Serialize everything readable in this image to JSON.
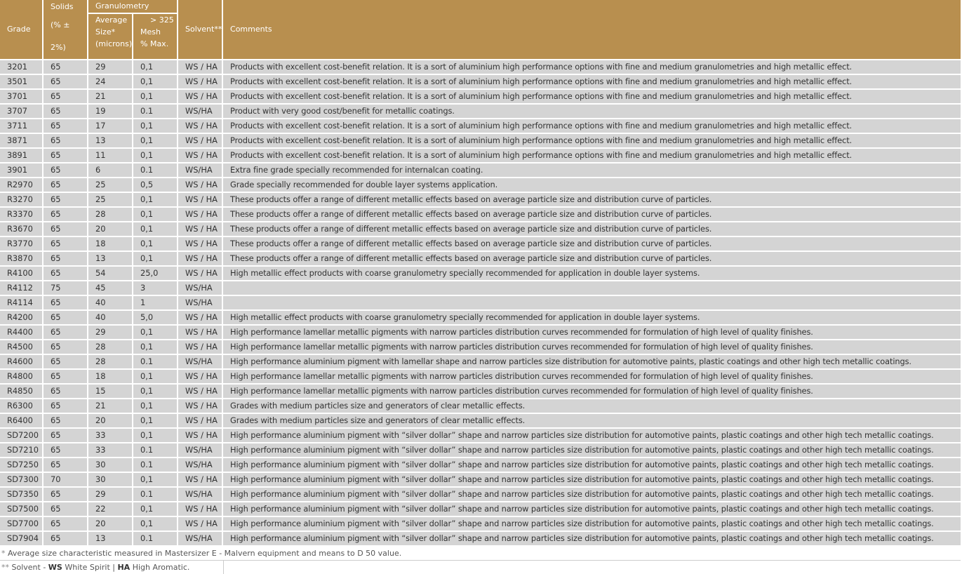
{
  "headers": {
    "grade": "Grade",
    "solids_top": "Solids",
    "solids_sub": "(% ± 2%)",
    "granulometry": "Granulometry",
    "avg_size": [
      "Average",
      "Size*",
      "(microns)"
    ],
    "mesh": [
      "> 325",
      "Mesh",
      "% Max."
    ],
    "solvent": "Solvent**",
    "comments": "Comments"
  },
  "rows": [
    {
      "grade": "3201",
      "solids": "65",
      "size": "29",
      "mesh": "0,1",
      "solvent": "WS / HA",
      "comment": "Products with excellent cost-benefit relation. It is a sort of aluminium high performance options with fine and medium granulometries and high metallic effect."
    },
    {
      "grade": "3501",
      "solids": "65",
      "size": "24",
      "mesh": "0,1",
      "solvent": "WS / HA",
      "comment": "Products with excellent cost-benefit relation. It is a sort of aluminium high performance options with fine and medium granulometries and high metallic effect."
    },
    {
      "grade": "3701",
      "solids": "65",
      "size": "21",
      "mesh": "0,1",
      "solvent": "WS / HA",
      "comment": "Products with excellent cost-benefit relation. It is a sort of aluminium high performance options with fine and medium granulometries and high metallic effect."
    },
    {
      "grade": "3707",
      "solids": "65",
      "size": "19",
      "mesh": "0.1",
      "solvent": "WS/HA",
      "comment": "Product with very good cost/benefit for metallic coatings."
    },
    {
      "grade": "3711",
      "solids": "65",
      "size": "17",
      "mesh": "0,1",
      "solvent": "WS / HA",
      "comment": "Products with excellent cost-benefit relation. It is a sort of aluminium high performance options with fine and medium granulometries and high metallic effect."
    },
    {
      "grade": "3871",
      "solids": "65",
      "size": "13",
      "mesh": "0,1",
      "solvent": "WS / HA",
      "comment": "Products with excellent cost-benefit relation. It is a sort of aluminium high performance options with fine and medium granulometries and high metallic effect."
    },
    {
      "grade": "3891",
      "solids": "65",
      "size": "11",
      "mesh": "0,1",
      "solvent": "WS / HA",
      "comment": "Products with excellent cost-benefit relation. It is a sort of aluminium high performance options with fine and medium granulometries and high metallic effect."
    },
    {
      "grade": "3901",
      "solids": "65",
      "size": "6",
      "mesh": "0.1",
      "solvent": "WS/HA",
      "comment": "Extra fine grade specially recommended for internalcan coating."
    },
    {
      "grade": "R2970",
      "solids": "65",
      "size": "25",
      "mesh": "0,5",
      "solvent": "WS / HA",
      "comment": "Grade specially recommended for double layer systems application."
    },
    {
      "grade": "R3270",
      "solids": "65",
      "size": "25",
      "mesh": "0,1",
      "solvent": "WS / HA",
      "comment": "These products offer a range of different metallic effects based on average particle size and distribution curve of particles."
    },
    {
      "grade": "R3370",
      "solids": "65",
      "size": "28",
      "mesh": "0,1",
      "solvent": "WS / HA",
      "comment": "These products offer a range of different metallic effects based on average particle size and distribution curve of particles."
    },
    {
      "grade": "R3670",
      "solids": "65",
      "size": "20",
      "mesh": "0,1",
      "solvent": "WS / HA",
      "comment": "These products offer a range of different metallic effects based on average particle size and distribution curve of particles."
    },
    {
      "grade": "R3770",
      "solids": "65",
      "size": "18",
      "mesh": "0,1",
      "solvent": "WS / HA",
      "comment": "These products offer a range of different metallic effects based on average particle size and distribution curve of particles."
    },
    {
      "grade": "R3870",
      "solids": "65",
      "size": "13",
      "mesh": "0,1",
      "solvent": "WS / HA",
      "comment": "These products offer a range of different metallic effects based on average particle size and distribution curve of particles."
    },
    {
      "grade": "R4100",
      "solids": "65",
      "size": "54",
      "mesh": "25,0",
      "solvent": "WS / HA",
      "comment": "High metallic effect products with coarse granulometry specially recommended for application in double layer systems."
    },
    {
      "grade": "R4112",
      "solids": "75",
      "size": "45",
      "mesh": "3",
      "solvent": "WS/HA",
      "comment": ""
    },
    {
      "grade": "R4114",
      "solids": "65",
      "size": "40",
      "mesh": "1",
      "solvent": "WS/HA",
      "comment": ""
    },
    {
      "grade": "R4200",
      "solids": "65",
      "size": "40",
      "mesh": "5,0",
      "solvent": "WS / HA",
      "comment": "High metallic effect products with coarse granulometry specially recommended for application in double layer systems."
    },
    {
      "grade": "R4400",
      "solids": "65",
      "size": "29",
      "mesh": "0,1",
      "solvent": "WS / HA",
      "comment": "High performance lamellar metallic pigments with narrow particles distribution curves recommended for formulation of high level of quality finishes."
    },
    {
      "grade": "R4500",
      "solids": "65",
      "size": "28",
      "mesh": "0,1",
      "solvent": "WS / HA",
      "comment": "High performance lamellar metallic pigments with narrow particles distribution curves recommended for formulation of high level of quality finishes."
    },
    {
      "grade": "R4600",
      "solids": "65",
      "size": "28",
      "mesh": "0.1",
      "solvent": "WS/HA",
      "comment": "High performance aluminium pigment with lamellar shape and narrow particles size distribution for automotive paints, plastic coatings and other high tech metallic coatings."
    },
    {
      "grade": "R4800",
      "solids": "65",
      "size": "18",
      "mesh": "0,1",
      "solvent": "WS / HA",
      "comment": "High performance lamellar metallic pigments with narrow particles distribution curves recommended for formulation of high level of quality finishes."
    },
    {
      "grade": "R4850",
      "solids": "65",
      "size": "15",
      "mesh": "0,1",
      "solvent": "WS / HA",
      "comment": "High performance lamellar metallic pigments with narrow particles distribution curves recommended for formulation of high level of quality finishes."
    },
    {
      "grade": "R6300",
      "solids": "65",
      "size": "21",
      "mesh": "0,1",
      "solvent": "WS / HA",
      "comment": "Grades with medium particles size and generators of clear metallic effects."
    },
    {
      "grade": "R6400",
      "solids": "65",
      "size": "20",
      "mesh": "0,1",
      "solvent": "WS / HA",
      "comment": "Grades with medium particles size and generators of clear metallic effects."
    },
    {
      "grade": "SD7200",
      "solids": "65",
      "size": "33",
      "mesh": "0,1",
      "solvent": "WS / HA",
      "comment": "High performance aluminium pigment with “silver dollar” shape and narrow particles size distribution for automotive paints, plastic coatings and other high tech metallic coatings."
    },
    {
      "grade": "SD7210",
      "solids": "65",
      "size": "33",
      "mesh": "0.1",
      "solvent": "WS/HA",
      "comment": "High performance aluminium pigment with “silver dollar” shape and narrow particles size distribution for automotive paints, plastic coatings and other high tech metallic coatings."
    },
    {
      "grade": "SD7250",
      "solids": "65",
      "size": "30",
      "mesh": "0.1",
      "solvent": "WS/HA",
      "comment": "High performance aluminium pigment with “silver dollar” shape and narrow particles size distribution for automotive paints, plastic coatings and other high tech metallic coatings."
    },
    {
      "grade": "SD7300",
      "solids": "70",
      "size": "30",
      "mesh": "0,1",
      "solvent": "WS / HA",
      "comment": "High performance aluminium pigment with “silver dollar” shape and narrow particles size distribution for automotive paints, plastic coatings and other high tech metallic coatings."
    },
    {
      "grade": "SD7350",
      "solids": "65",
      "size": "29",
      "mesh": "0.1",
      "solvent": "WS/HA",
      "comment": "High performance aluminium pigment with “silver dollar” shape and narrow particles size distribution for automotive paints, plastic coatings and other high tech metallic coatings."
    },
    {
      "grade": "SD7500",
      "solids": "65",
      "size": "22",
      "mesh": "0,1",
      "solvent": "WS / HA",
      "comment": "High performance aluminium pigment with “silver dollar” shape and narrow particles size distribution for automotive paints, plastic coatings and other high tech metallic coatings."
    },
    {
      "grade": "SD7700",
      "solids": "65",
      "size": "20",
      "mesh": "0,1",
      "solvent": "WS / HA",
      "comment": "High performance aluminium pigment with “silver dollar” shape and narrow particles size distribution for automotive paints, plastic coatings and other high tech metallic coatings."
    },
    {
      "grade": "SD7904",
      "solids": "65",
      "size": "13",
      "mesh": "0.1",
      "solvent": "WS/HA",
      "comment": "High performance aluminium pigment with “silver dollar” shape and narrow particles size distribution for automotive paints, plastic coatings and other high tech metallic coatings."
    }
  ],
  "footnotes": {
    "note1_star": "*",
    "note1": "Average size characteristic measured in Mastersizer E - Malvern equipment and means to D 50 value.",
    "note2_star": "**",
    "note2_prefix": "Solvent -",
    "ws_abbr": "WS",
    "ws_text": "White Spirit |",
    "ha_abbr": "HA",
    "ha_text": "High Aromatic."
  },
  "colors": {
    "header_bg": "#b88f4f",
    "row_bg": "#d4d4d4"
  }
}
